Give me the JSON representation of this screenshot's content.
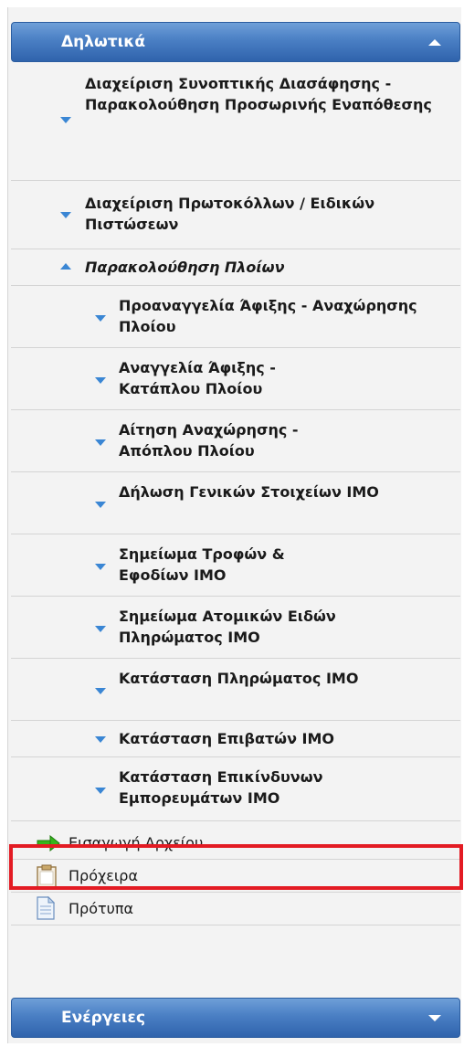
{
  "panel": {
    "title": "Δηλωτικά",
    "items": [
      {
        "label": "Διαχείριση Συνοπτικής Διασάφησης - Παρακολούθηση Προσωρινής Εναπόθεσης"
      },
      {
        "label": "Διαχείριση Πρωτοκόλλων / Ειδικών Πιστώσεων"
      },
      {
        "label": "Παρακολούθηση Πλοίων"
      }
    ],
    "sub_items": [
      {
        "label": "Προαναγγελία Άφιξης - Αναχώρησης Πλοίου"
      },
      {
        "label": "Αναγγελία Άφιξης - Κατάπλου Πλοίου"
      },
      {
        "label": "Αίτηση Αναχώρησης - Απόπλου Πλοίου"
      },
      {
        "label": "Δήλωση Γενικών Στοιχείων IMO"
      },
      {
        "label": "Σημείωμα Τροφών & Εφοδίων IMO"
      },
      {
        "label": "Σημείωμα Ατομικών Ειδών Πληρώματος IMO"
      },
      {
        "label": "Κατάσταση Πληρώματος IMO"
      },
      {
        "label": "Κατάσταση Επιβατών IMO"
      },
      {
        "label": "Κατάσταση Επικίνδυνων Εμπορευμάτων IMO"
      }
    ],
    "actions": [
      {
        "label": "Εισαγωγή Αρχείου",
        "icon": "green-arrow-right-icon"
      },
      {
        "label": "Πρόχειρα",
        "icon": "clipboard-icon"
      },
      {
        "label": "Πρότυπα",
        "icon": "document-icon"
      }
    ]
  },
  "actions_panel": {
    "title": "Ενέργειες"
  },
  "colors": {
    "header_blue": "#4a7fc4",
    "arrow_blue": "#3a86d4",
    "highlight_red": "#e31b23",
    "green_arrow": "#35b61c"
  }
}
